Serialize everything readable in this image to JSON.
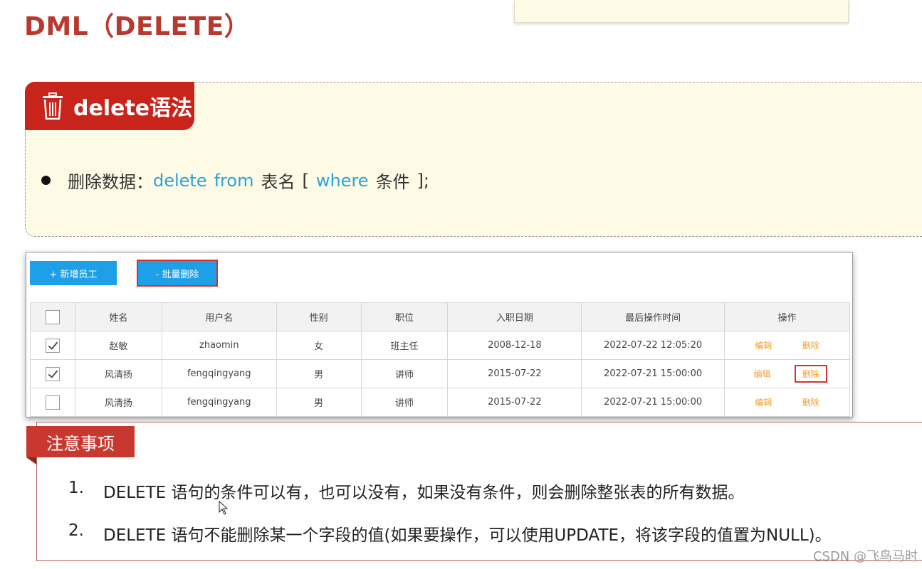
{
  "page": {
    "title": "DML（DELETE）"
  },
  "syntax": {
    "tag_label": "delete语法",
    "line": {
      "prefix": "删除数据：",
      "kw_delete": "delete",
      "kw_from": "from",
      "table_name": "表名",
      "open_bracket": "[",
      "kw_where": "where",
      "condition": "条件",
      "close": "];"
    }
  },
  "toolbar": {
    "add_label": "+ 新增员工",
    "batch_delete_label": "- 批量删除"
  },
  "table": {
    "headers": [
      "姓名",
      "用户名",
      "性别",
      "职位",
      "入职日期",
      "最后操作时间",
      "操作"
    ],
    "rows": [
      {
        "checked": true,
        "name": "赵敏",
        "username": "zhaomin",
        "gender": "女",
        "position": "班主任",
        "entry_date": "2008-12-18",
        "last_op": "2022-07-22 12:05:20",
        "edit": "编辑",
        "delete": "删除"
      },
      {
        "checked": true,
        "name": "风清扬",
        "username": "fengqingyang",
        "gender": "男",
        "position": "讲师",
        "entry_date": "2015-07-22",
        "last_op": "2022-07-21 15:00:00",
        "edit": "编辑",
        "delete": "删除"
      },
      {
        "checked": false,
        "name": "风清扬",
        "username": "fengqingyang",
        "gender": "男",
        "position": "讲师",
        "entry_date": "2015-07-22",
        "last_op": "2022-07-21 15:00:00",
        "edit": "编辑",
        "delete": "删除"
      }
    ]
  },
  "notice": {
    "tag_label": "注意事项",
    "items": [
      {
        "num": "1.",
        "text": "DELETE 语句的条件可以有，也可以没有，如果没有条件，则会删除整张表的所有数据。"
      },
      {
        "num": "2.",
        "text": "DELETE 语句不能删除某一个字段的值(如果要操作，可以使用UPDATE，将该字段的值置为NULL)。"
      }
    ]
  },
  "watermark": "CSDN @飞鸟马时",
  "colors": {
    "accent_red": "#c8241c",
    "keyword_blue": "#2aa2db",
    "button_blue": "#1ea0e8",
    "action_orange": "#f0a030",
    "panel_bg": "#fdfbe6"
  }
}
